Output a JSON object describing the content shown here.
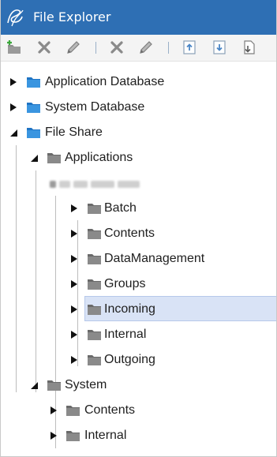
{
  "window": {
    "title": "File Explorer"
  },
  "toolbar": {
    "buttons": [
      {
        "name": "add-folder-button",
        "icon": "add-folder-icon"
      },
      {
        "name": "delete-button",
        "icon": "delete-x-icon"
      },
      {
        "name": "rename-button",
        "icon": "pencil-icon"
      },
      {
        "name": "delete-file-button",
        "icon": "delete-x-icon"
      },
      {
        "name": "edit-file-button",
        "icon": "pencil-icon"
      },
      {
        "name": "upload-button",
        "icon": "upload-doc-icon"
      },
      {
        "name": "download-button",
        "icon": "download-doc-icon"
      },
      {
        "name": "move-button",
        "icon": "move-doc-icon"
      }
    ]
  },
  "tree": {
    "application_database": "Application Database",
    "system_database": "System Database",
    "file_share": "File Share",
    "applications": "Applications",
    "app_folders": {
      "batch": "Batch",
      "contents": "Contents",
      "data_management": "DataManagement",
      "groups": "Groups",
      "incoming": "Incoming",
      "internal": "Internal",
      "outgoing": "Outgoing"
    },
    "system": "System",
    "system_folders": {
      "contents": "Contents",
      "internal": "Internal"
    },
    "selected": "Incoming"
  },
  "colors": {
    "titlebar": "#2e6fb4",
    "selection": "#d9e3f6",
    "blue_folder": "#2a8ad8",
    "gray_folder": "#7d7d7d"
  }
}
